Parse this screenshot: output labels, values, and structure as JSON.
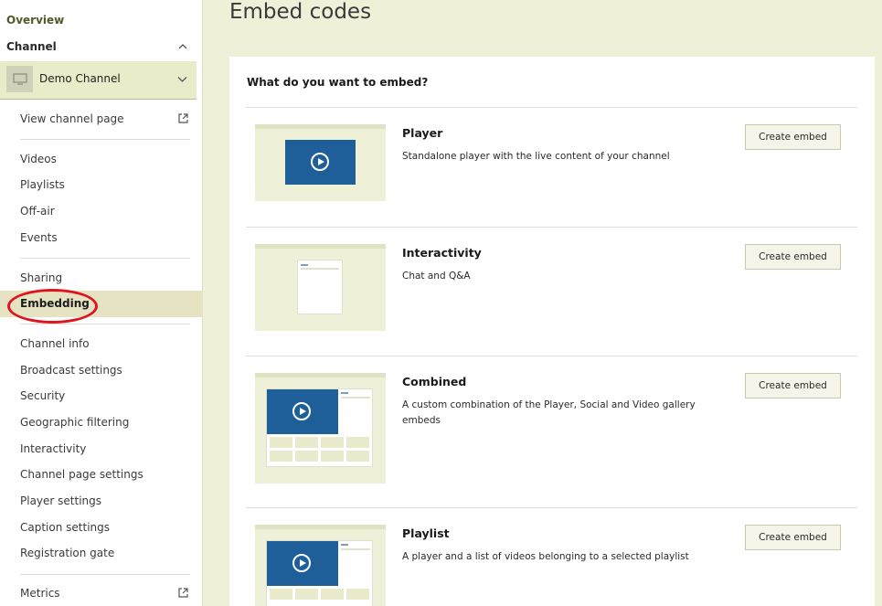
{
  "sidebar": {
    "overview": "Overview",
    "channel_label": "Channel",
    "channel_select": "Demo Channel",
    "items": [
      {
        "label": "View channel page"
      },
      {
        "label": "Videos"
      },
      {
        "label": "Playlists"
      },
      {
        "label": "Off-air"
      },
      {
        "label": "Events"
      },
      {
        "label": "Sharing"
      },
      {
        "label": "Embedding"
      },
      {
        "label": "Channel info"
      },
      {
        "label": "Broadcast settings"
      },
      {
        "label": "Security"
      },
      {
        "label": "Geographic filtering"
      },
      {
        "label": "Interactivity"
      },
      {
        "label": "Channel page settings"
      },
      {
        "label": "Player settings"
      },
      {
        "label": "Caption settings"
      },
      {
        "label": "Registration gate"
      },
      {
        "label": "Metrics"
      }
    ],
    "active": "Embedding",
    "icons": {
      "chevron_up": "chevron-up-icon",
      "chevron_down": "chevron-down-icon",
      "external": "external-link-icon",
      "monitor": "monitor-icon"
    }
  },
  "main": {
    "title": "Embed codes",
    "question": "What do you want to embed?",
    "rows": [
      {
        "title": "Player",
        "desc": "Standalone player with the live content of your channel",
        "button": "Create embed"
      },
      {
        "title": "Interactivity",
        "desc": "Chat and Q&A",
        "button": "Create embed"
      },
      {
        "title": "Combined",
        "desc": "A custom combination of the Player, Social and Video gallery embeds",
        "button": "Create embed"
      },
      {
        "title": "Playlist",
        "desc": "A player and a list of videos belonging to a selected playlist",
        "button": "Create embed"
      }
    ]
  },
  "colors": {
    "accent_blue": "#1f5f99",
    "highlight_red": "#e0141e",
    "background": "#eef0d8"
  }
}
